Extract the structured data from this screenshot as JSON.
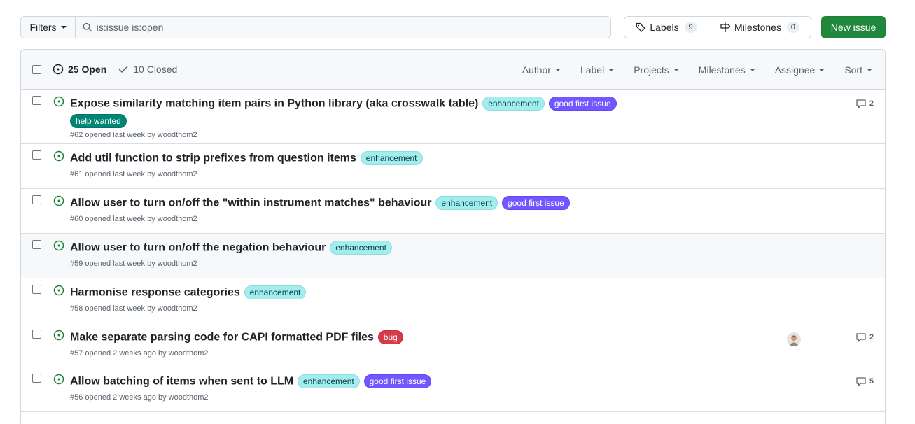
{
  "toolbar": {
    "filters_label": "Filters",
    "search_value": "is:issue is:open",
    "labels_label": "Labels",
    "labels_count": "9",
    "milestones_label": "Milestones",
    "milestones_count": "0",
    "new_issue_label": "New issue"
  },
  "header": {
    "open_label": "25 Open",
    "closed_label": "10 Closed",
    "filters": [
      "Author",
      "Label",
      "Projects",
      "Milestones",
      "Assignee",
      "Sort"
    ]
  },
  "issues": [
    {
      "title": "Expose similarity matching item pairs in Python library (aka crosswalk table)",
      "labels": [
        "enhancement",
        "good first issue"
      ],
      "extra_label": "help wanted",
      "meta": "#62 opened last week by woodthom2",
      "comments": "2"
    },
    {
      "title": "Add util function to strip prefixes from question items",
      "labels": [
        "enhancement"
      ],
      "meta": "#61 opened last week by woodthom2"
    },
    {
      "title": "Allow user to turn on/off the \"within instrument matches\" behaviour",
      "labels": [
        "enhancement",
        "good first issue"
      ],
      "meta": "#60 opened last week by woodthom2"
    },
    {
      "title": "Allow user to turn on/off the negation behaviour",
      "labels": [
        "enhancement"
      ],
      "meta": "#59 opened last week by woodthom2"
    },
    {
      "title": "Harmonise response categories",
      "labels": [
        "enhancement"
      ],
      "meta": "#58 opened last week by woodthom2"
    },
    {
      "title": "Make separate parsing code for CAPI formatted PDF files",
      "labels": [
        "bug"
      ],
      "meta": "#57 opened 2 weeks ago by woodthom2",
      "comments": "2"
    },
    {
      "title": "Allow batching of items when sent to LLM",
      "labels": [
        "enhancement",
        "good first issue"
      ],
      "meta": "#56 opened 2 weeks ago by woodthom2",
      "comments": "5"
    }
  ],
  "colors": {
    "accent_green": "#1f883d",
    "open_icon": "#1a7f37",
    "label_enhancement": "#a2eeef",
    "label_good_first_issue": "#7057ff",
    "label_help_wanted": "#008672",
    "label_bug": "#d73a4a"
  },
  "icons": {
    "search": "magnifier",
    "labels": "tag",
    "milestones": "signpost",
    "open_issue": "circle-dot",
    "closed": "check",
    "comments": "speech-bubble"
  }
}
